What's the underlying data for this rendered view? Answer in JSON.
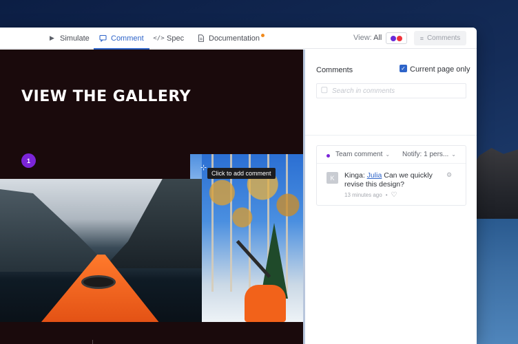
{
  "toolbar": {
    "tabs": [
      {
        "label": "Simulate",
        "icon": "play-icon"
      },
      {
        "label": "Comment",
        "icon": "comment-icon"
      },
      {
        "label": "Spec",
        "icon": "code-icon"
      },
      {
        "label": "Documentation",
        "icon": "document-icon"
      }
    ],
    "active_tab": "Comment",
    "view_prefix": "View:",
    "view_value": "All",
    "comments_button": "Comments",
    "colors": {
      "accent": "#2e64c9",
      "badge": "#f18a1c",
      "toggle_a": "#6a2bd9",
      "toggle_b": "#f0333c"
    }
  },
  "canvas": {
    "title": "VIEW THE GALLERY",
    "pin_number": "1",
    "tooltip": "Click to add comment",
    "prev_arrow": "←",
    "next_arrow": "→"
  },
  "panel": {
    "title": "Comments",
    "current_page_only_label": "Current page only",
    "current_page_only_checked": true,
    "search_placeholder": "Search in comments",
    "thread": {
      "channel": "Team comment",
      "notify": "Notify: 1 pers...",
      "avatar_initial": "K",
      "author": "Kinga:",
      "mention": "Julia",
      "text": "Can we quickly revise this design?",
      "time": "13 minutes ago",
      "separator": "•"
    }
  }
}
